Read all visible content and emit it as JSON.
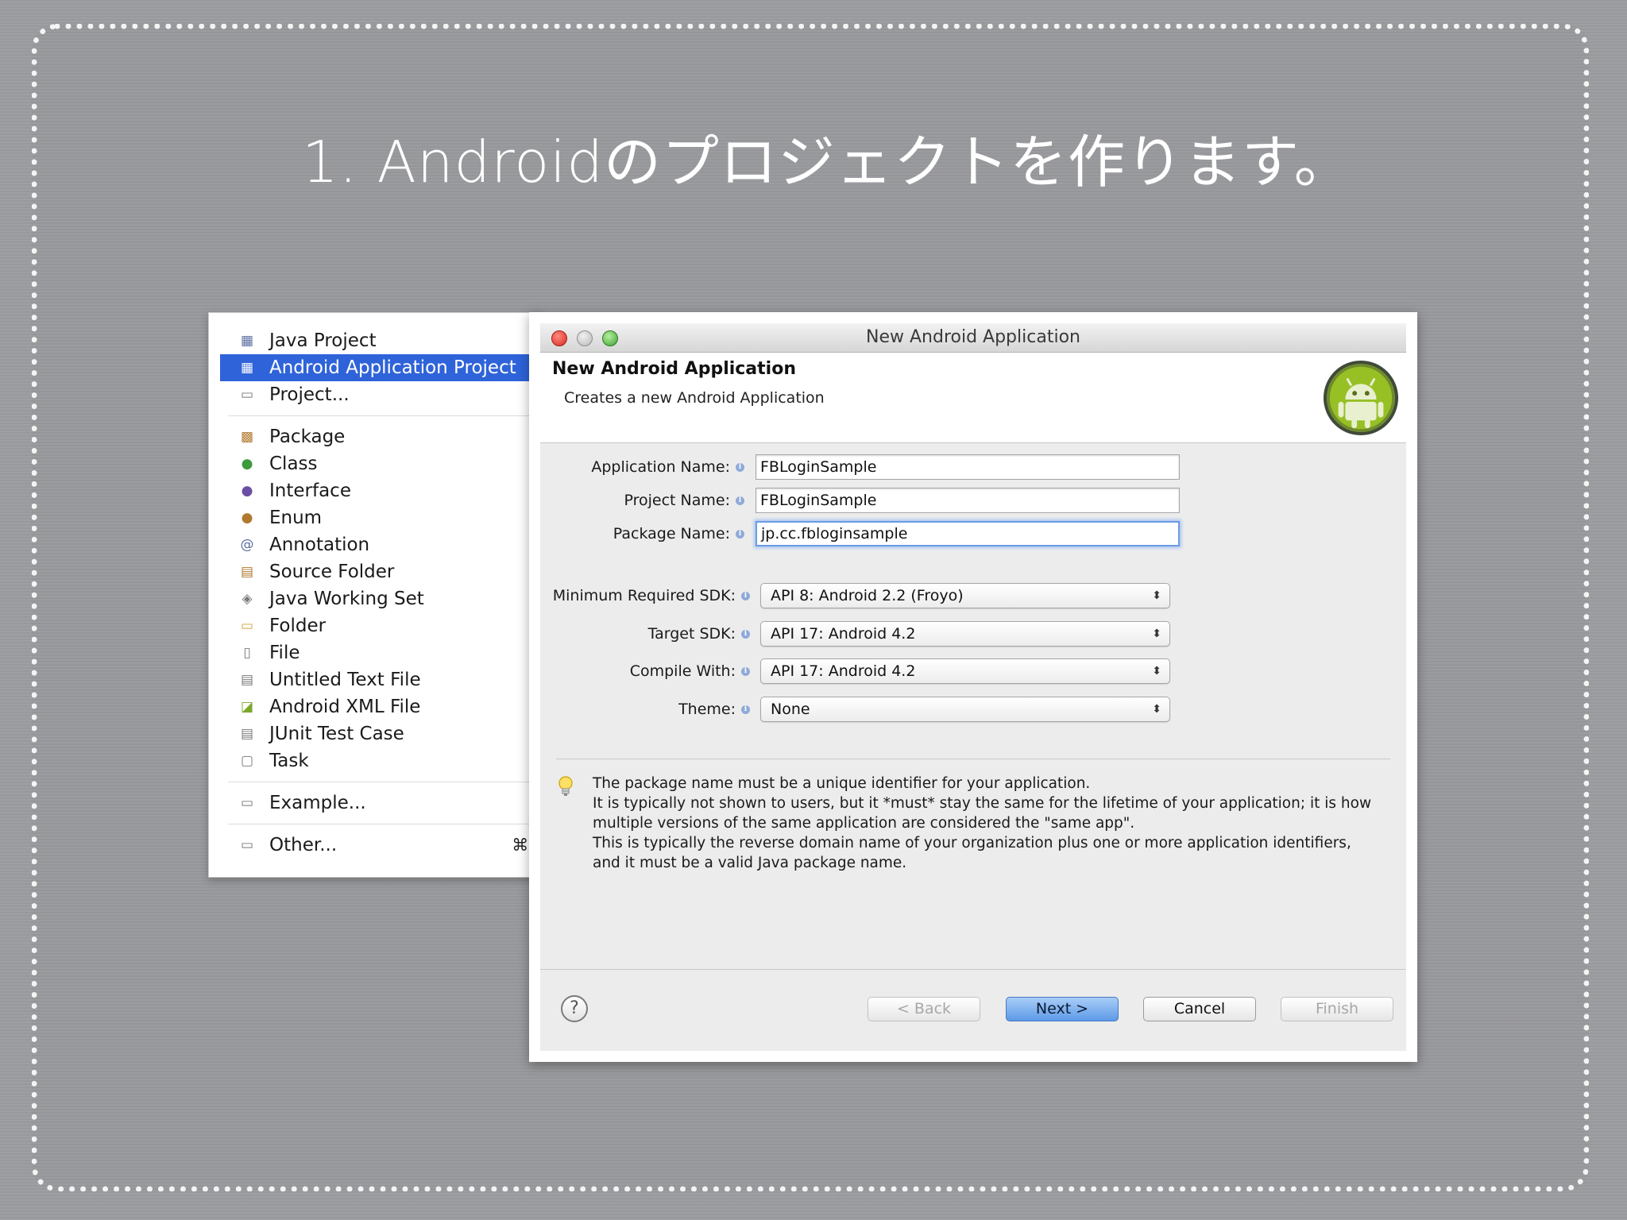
{
  "slide": {
    "title": "1. Androidのプロジェクトを作ります。"
  },
  "new_menu": {
    "items": [
      {
        "label": "Java Project",
        "icon": "java-project-icon",
        "selected": false
      },
      {
        "label": "Android Application Project",
        "icon": "android-project-icon",
        "selected": true
      },
      {
        "label": "Project...",
        "icon": "project-icon",
        "selected": false
      },
      {
        "label": "Package",
        "icon": "package-icon",
        "selected": false
      },
      {
        "label": "Class",
        "icon": "class-icon",
        "selected": false
      },
      {
        "label": "Interface",
        "icon": "interface-icon",
        "selected": false
      },
      {
        "label": "Enum",
        "icon": "enum-icon",
        "selected": false
      },
      {
        "label": "Annotation",
        "icon": "annotation-icon",
        "selected": false
      },
      {
        "label": "Source Folder",
        "icon": "source-folder-icon",
        "selected": false
      },
      {
        "label": "Java Working Set",
        "icon": "working-set-icon",
        "selected": false
      },
      {
        "label": "Folder",
        "icon": "folder-icon",
        "selected": false
      },
      {
        "label": "File",
        "icon": "file-icon",
        "selected": false
      },
      {
        "label": "Untitled Text File",
        "icon": "text-file-icon",
        "selected": false
      },
      {
        "label": "Android XML File",
        "icon": "android-xml-icon",
        "selected": false
      },
      {
        "label": "JUnit Test Case",
        "icon": "junit-icon",
        "selected": false
      },
      {
        "label": "Task",
        "icon": "task-icon",
        "selected": false
      },
      {
        "label": "Example...",
        "icon": "example-icon",
        "selected": false
      },
      {
        "label": "Other...",
        "icon": "other-icon",
        "selected": false
      }
    ],
    "other_shortcut": "⌘N"
  },
  "dialog": {
    "window_title": "New Android Application",
    "header_title": "New Android Application",
    "header_subtitle": "Creates a new Android Application",
    "form": {
      "application_name": {
        "label": "Application Name:",
        "value": "FBLoginSample"
      },
      "project_name": {
        "label": "Project Name:",
        "value": "FBLoginSample"
      },
      "package_name": {
        "label": "Package Name:",
        "value": "jp.cc.fbloginsample"
      },
      "min_sdk": {
        "label": "Minimum Required SDK:",
        "value": "API 8: Android 2.2 (Froyo)"
      },
      "target_sdk": {
        "label": "Target SDK:",
        "value": "API 17: Android 4.2"
      },
      "compile_with": {
        "label": "Compile With:",
        "value": "API 17: Android 4.2"
      },
      "theme": {
        "label": "Theme:",
        "value": "None"
      }
    },
    "info": {
      "line1": "The package name must be a unique identifier for your application.",
      "line2": "It is typically not shown to users, but it *must* stay the same for the lifetime of your application; it is how",
      "line3": "multiple versions of the same application are considered the \"same app\".",
      "line4": "This is typically the reverse domain name of your organization plus one or more application identifiers,",
      "line5": "and it must be a valid Java package name."
    },
    "buttons": {
      "help": "?",
      "back": "< Back",
      "next": "Next >",
      "cancel": "Cancel",
      "finish": "Finish"
    }
  },
  "colors": {
    "selection": "#2f63d9",
    "default_button": "#5d9ae8",
    "android_green": "#97c024"
  }
}
